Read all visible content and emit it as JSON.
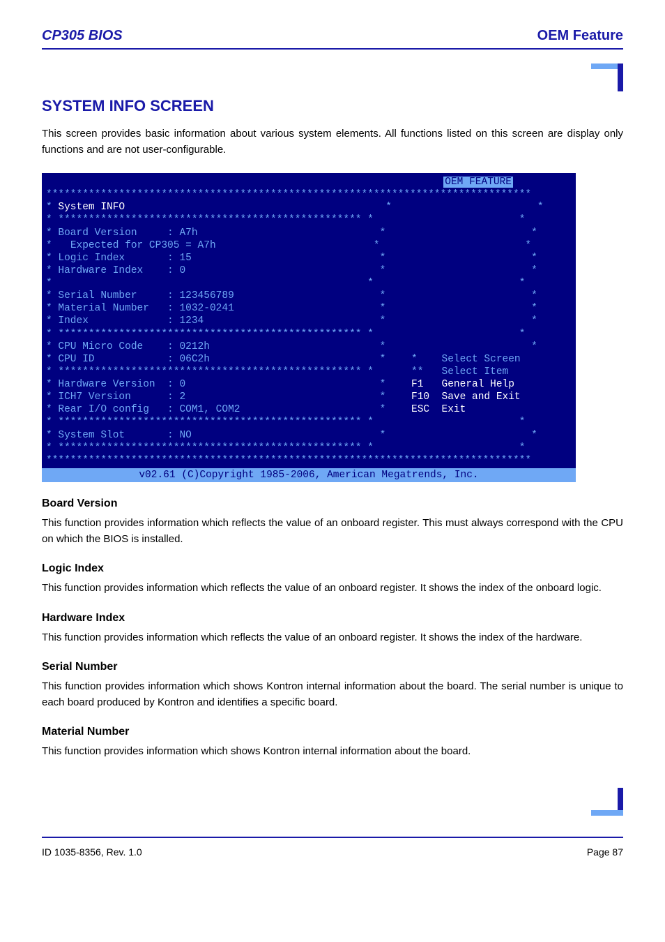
{
  "header": {
    "left": "CP305 BIOS",
    "right": "OEM Feature"
  },
  "section_title": "SYSTEM INFO SCREEN",
  "intro": "This screen provides basic information about various system elements. All functions listed on this screen are display only functions and are not user-configurable.",
  "bios_screen": {
    "tab": "OEM FEATURE",
    "title": "System INFO",
    "fields": {
      "board_version": {
        "label": "Board Version",
        "value": "A7h"
      },
      "expected": "Expected for CP305 = A7h",
      "logic_index": {
        "label": "Logic Index",
        "value": "15"
      },
      "hardware_index": {
        "label": "Hardware Index",
        "value": "0"
      },
      "serial_number": {
        "label": "Serial Number",
        "value": "123456789"
      },
      "material_number": {
        "label": "Material Number",
        "value": "1032-0241"
      },
      "index": {
        "label": "Index",
        "value": "1234"
      },
      "cpu_micro_code": {
        "label": "CPU Micro Code",
        "value": "0212h"
      },
      "cpu_id": {
        "label": "CPU ID",
        "value": "06C2h"
      },
      "hardware_version": {
        "label": "Hardware Version",
        "value": "0"
      },
      "ich7_version": {
        "label": "ICH7 Version",
        "value": "2"
      },
      "rear_io": {
        "label": "Rear I/O config",
        "value": "COM1, COM2"
      },
      "system_slot": {
        "label": "System Slot",
        "value": "NO"
      }
    },
    "help": {
      "select_screen_key": "*",
      "select_screen": "Select Screen",
      "select_item_key": "**",
      "select_item": "Select Item",
      "f1_key": "F1",
      "f1": "General Help",
      "f10_key": "F10",
      "f10": "Save and Exit",
      "esc_key": "ESC",
      "esc": "Exit"
    },
    "copyright": "v02.61 (C)Copyright 1985-2006, American Megatrends, Inc."
  },
  "subs": {
    "board_version": {
      "title": "Board Version",
      "body": "This function provides information which reflects the value of an onboard register. This must always correspond with the CPU on which the BIOS is installed."
    },
    "logic_index": {
      "title": "Logic Index",
      "body": "This function provides information which reflects the value of an onboard register. It shows the index of the onboard logic."
    },
    "hardware_index": {
      "title": "Hardware Index",
      "body": "This function provides information which reflects the value of an onboard register. It shows the index of the hardware."
    },
    "serial_number": {
      "title": "Serial Number",
      "body": "This function provides information which shows Kontron internal information about the board. The serial number is unique to each board produced by Kontron and identifies a specific board."
    },
    "material_number": {
      "title": "Material Number",
      "body": "This function provides information which shows Kontron internal information about the board."
    }
  },
  "footer": {
    "left": "ID 1035-8356, Rev. 1.0",
    "right": "Page 87"
  }
}
